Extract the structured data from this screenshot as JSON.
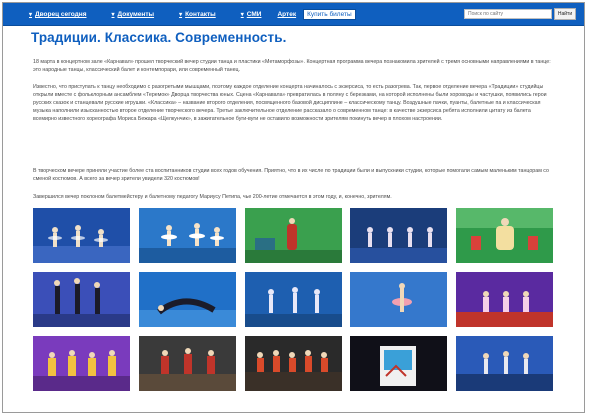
{
  "nav": {
    "items": [
      "Дворец сегодня",
      "Документы",
      "Контакты",
      "СМИ"
    ],
    "artek": "Артек",
    "buy": "Купить билеты",
    "search_placeholder": "Поиск по сайту",
    "search_button": "Найти"
  },
  "article": {
    "title": "Традиции. Классика. Современность.",
    "p1": "18 марта в концертном зале «Карнавал» прошел творческий вечер студии танца и пластики «Метаморфозы». Концертная программа вечера познакомила зрителей с тремя основными направлениями в танце: это народные танцы, классический балет и контемпорари, или современный танец.",
    "p2": "Известно, что приступать к танцу необходимо с разогретыми мышцами, поэтому каждое отделение концерта начиналось с экзерсиса, то есть разогрева. Так, первое отделение вечера «Традиции» студийцы открыли вместе с фольклорным ансамблем «Теремок» Дворца творчества юных. Сцена «Карнавала» превратилась в поляну с березками, на которой исполнены были хороводы и частушки, появились герои русских сказок и станцевали русские игрушки. «Классика» – название второго отделения, посвященного базовой дисциплине – классическому танцу. Воздушные пачки, пуанты, балетные па и классическая музыка наполнили изысканностью второе отделение творческого вечера. Третье заключительное отделение рассказало о современном танце: в качестве экзерсиса ребята исполнили цитату из балета всемирно известного хореографа Мориса Бежара «Щелкунчик», в зажигательное буги-вуги не оставило возможности зрителям покинуть вечер в плохом настроении.",
    "p3": "В творческом вечере приняли участие более ста воспитанников студии всех годов обучения. Приятно, что в их числе по традиции были и выпускники студии, которые помогали самым маленьким танцорам со сменой костюмов. А всего за вечер зрители увидели 320 костюмов!",
    "p4": "Завершился вечер поклоном балетмейстеру и балетному педагогу Мариусу Петипа, чье 200-летие отмечается в этом году, и, конечно, зрителям."
  },
  "gallery": {
    "count": 15,
    "colors": {
      "stage_blue": "#1f4fa8",
      "stage_green": "#2f9a4a",
      "stage_dark": "#1b1b2a",
      "stage_red": "#c0342a",
      "stage_purple": "#7a3bbd"
    }
  },
  "colors": {
    "accent": "#0f5fbf",
    "text": "#4a4a4a"
  }
}
